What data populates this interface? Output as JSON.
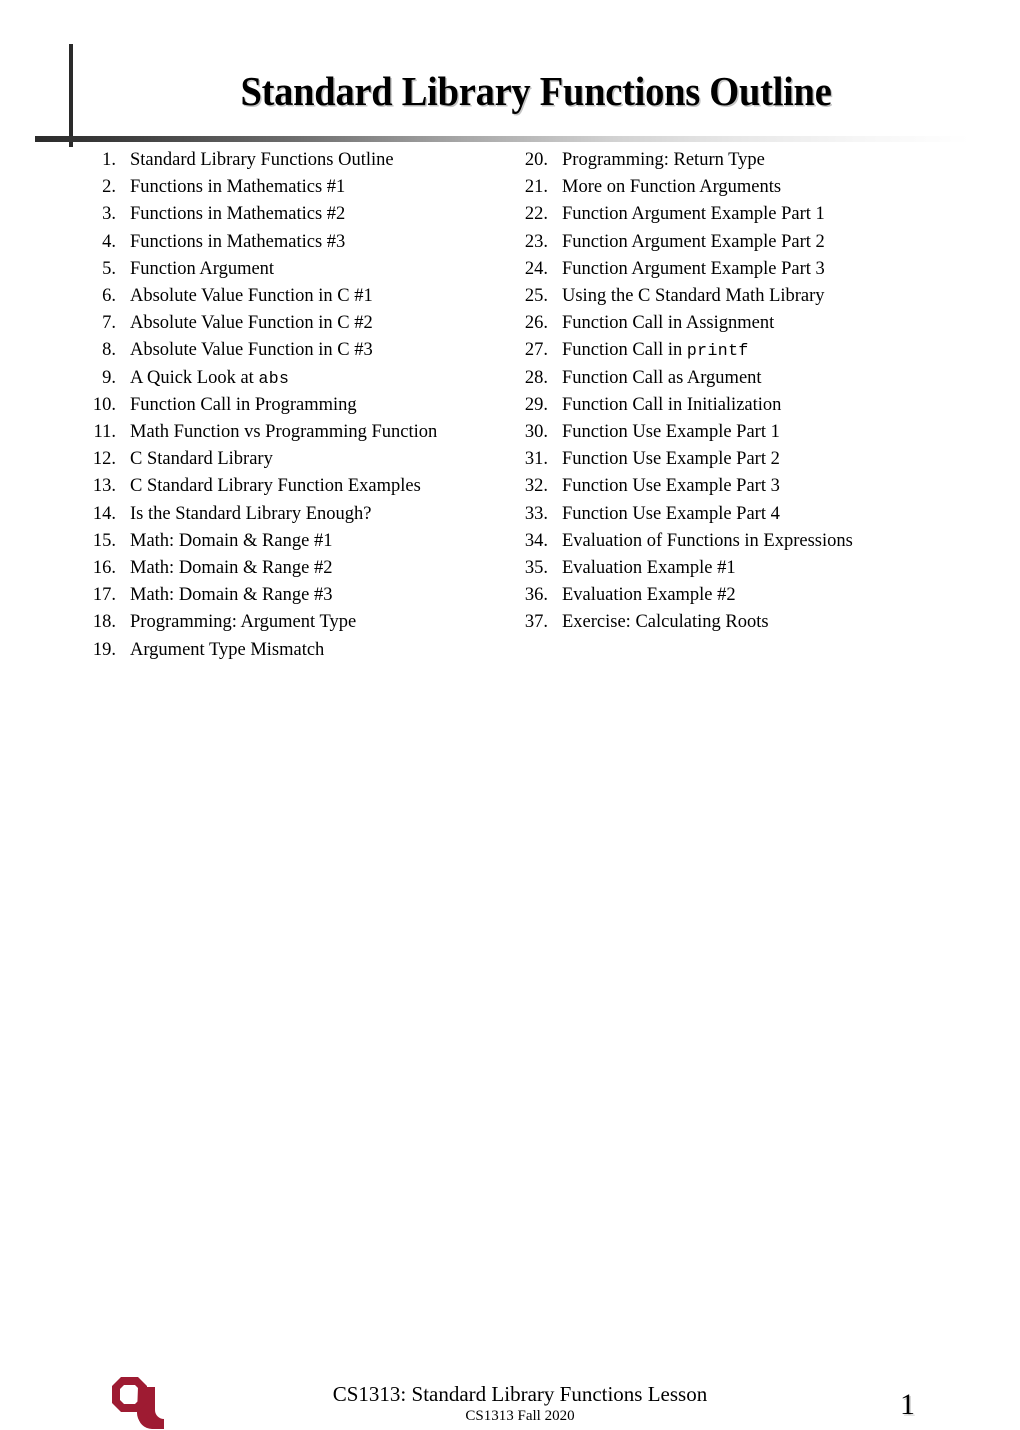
{
  "slide": {
    "title": "Standard Library Functions Outline",
    "page_number": "1"
  },
  "colors": {
    "ou_crimson": "#9E1B32",
    "rule_dark": "#2B2B2B",
    "text": "#000000",
    "background": "#FFFFFF"
  },
  "outline": {
    "left_column": [
      {
        "number": "1.",
        "text": "Standard Library Functions Outline",
        "code": ""
      },
      {
        "number": "2.",
        "text": "Functions in Mathematics #1",
        "code": ""
      },
      {
        "number": "3.",
        "text": "Functions in Mathematics #2",
        "code": ""
      },
      {
        "number": "4.",
        "text": "Functions in Mathematics #3",
        "code": ""
      },
      {
        "number": "5.",
        "text": "Function Argument",
        "code": ""
      },
      {
        "number": "6.",
        "text": "Absolute Value Function in C #1",
        "code": ""
      },
      {
        "number": "7.",
        "text": "Absolute Value Function in C #2",
        "code": ""
      },
      {
        "number": "8.",
        "text": "Absolute Value Function in C #3",
        "code": ""
      },
      {
        "number": "9.",
        "text": "A Quick Look at ",
        "code": "abs"
      },
      {
        "number": "10.",
        "text": "Function Call in Programming",
        "code": ""
      },
      {
        "number": "11.",
        "text": "Math Function vs Programming Function",
        "code": ""
      },
      {
        "number": "12.",
        "text": "C Standard Library",
        "code": ""
      },
      {
        "number": "13.",
        "text": "C Standard Library Function Examples",
        "code": ""
      },
      {
        "number": "14.",
        "text": "Is the Standard Library Enough?",
        "code": ""
      },
      {
        "number": "15.",
        "text": "Math: Domain & Range #1",
        "code": ""
      },
      {
        "number": "16.",
        "text": "Math: Domain & Range #2",
        "code": ""
      },
      {
        "number": "17.",
        "text": "Math: Domain & Range #3",
        "code": ""
      },
      {
        "number": "18.",
        "text": "Programming: Argument Type",
        "code": ""
      },
      {
        "number": "19.",
        "text": "Argument Type Mismatch",
        "code": ""
      }
    ],
    "right_column": [
      {
        "number": "20.",
        "text": "Programming: Return Type",
        "code": ""
      },
      {
        "number": "21.",
        "text": "More on Function Arguments",
        "code": ""
      },
      {
        "number": "22.",
        "text": "Function Argument Example Part 1",
        "code": ""
      },
      {
        "number": "23.",
        "text": "Function Argument Example Part 2",
        "code": ""
      },
      {
        "number": "24.",
        "text": "Function Argument Example Part 3",
        "code": ""
      },
      {
        "number": "25.",
        "text": "Using the C Standard Math Library",
        "code": ""
      },
      {
        "number": "26.",
        "text": "Function Call in Assignment",
        "code": ""
      },
      {
        "number": "27.",
        "text": "Function Call in ",
        "code": "printf"
      },
      {
        "number": "28.",
        "text": "Function Call as Argument",
        "code": ""
      },
      {
        "number": "29.",
        "text": "Function Call in Initialization",
        "code": ""
      },
      {
        "number": "30.",
        "text": "Function Use Example Part 1",
        "code": ""
      },
      {
        "number": "31.",
        "text": "Function Use Example Part 2",
        "code": ""
      },
      {
        "number": "32.",
        "text": "Function Use Example Part 3",
        "code": ""
      },
      {
        "number": "33.",
        "text": "Function Use Example Part 4",
        "code": ""
      },
      {
        "number": "34.",
        "text": "Evaluation of Functions in Expressions",
        "code": ""
      },
      {
        "number": "35.",
        "text": "Evaluation Example #1",
        "code": ""
      },
      {
        "number": "36.",
        "text": "Evaluation Example #2",
        "code": ""
      },
      {
        "number": "37.",
        "text": "Exercise: Calculating Roots",
        "code": ""
      }
    ]
  },
  "footer": {
    "logo_name": "ou-logo",
    "lesson_title": "CS1313: Standard Library Functions Lesson",
    "course_term": "CS1313 Fall 2020"
  }
}
